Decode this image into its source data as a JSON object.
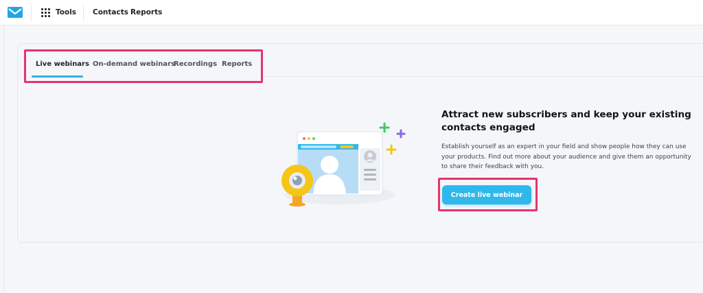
{
  "topbar": {
    "logo_icon": "envelope-logo-icon",
    "tools_icon": "grid-dots-icon",
    "tools_label": "Tools",
    "nav": [
      {
        "label": "Contacts"
      },
      {
        "label": "Reports"
      }
    ]
  },
  "tabs": [
    {
      "label": "Live webinars",
      "active": true
    },
    {
      "label": "On-demand webinars",
      "active": false
    },
    {
      "label": "Recordings",
      "active": false
    },
    {
      "label": "Reports",
      "active": false
    }
  ],
  "empty_state": {
    "illustration": "webinar-window-webcam-illustration",
    "headline": "Attract new subscribers and keep your existing contacts engaged",
    "description": "Establish yourself as an expert in your field and show people how they can use your products. Find out more about your audience and give them an opportunity to share their feedback with you.",
    "cta_label": "Create live webinar"
  },
  "colors": {
    "brand": "#2eb8ec",
    "tab_indicator": "#2fb0e8",
    "highlight": "#e5336b",
    "webcam": "#f5c518"
  }
}
